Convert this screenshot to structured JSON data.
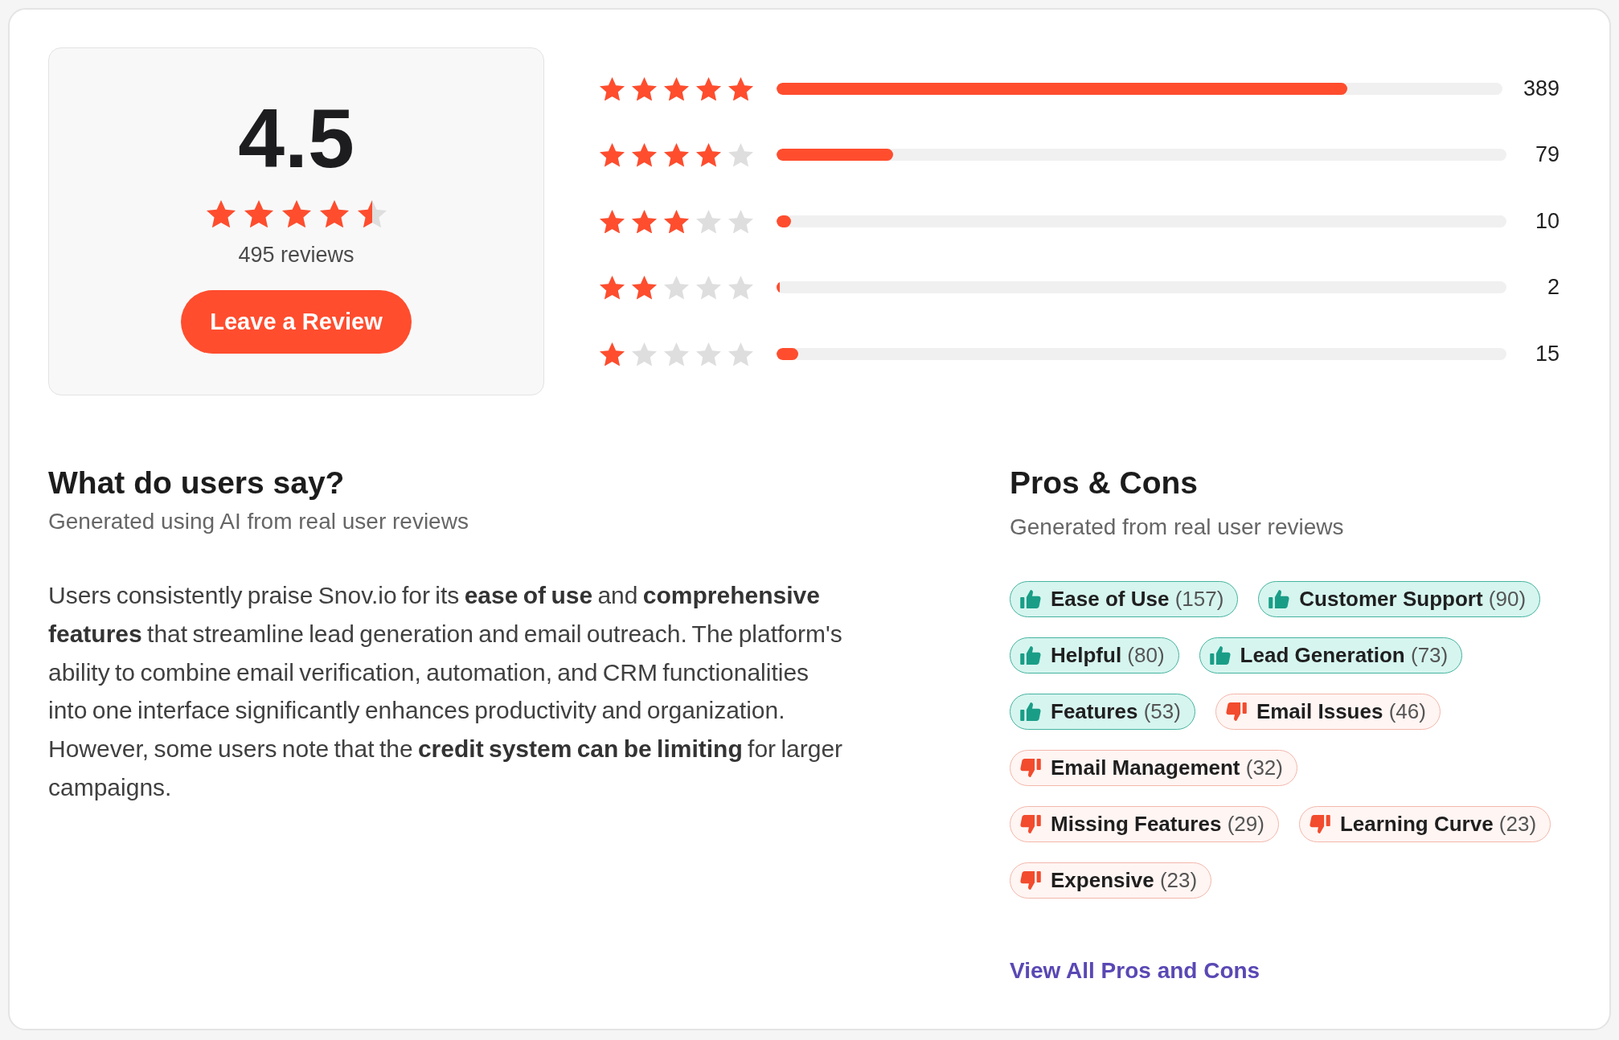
{
  "rating_summary": {
    "score": "4.5",
    "stars": 4.5,
    "reviews": "495 reviews",
    "button": "Leave a Review"
  },
  "distribution": [
    {
      "stars": 5,
      "level": 0.786,
      "count": "389"
    },
    {
      "stars": 4,
      "level": 0.16,
      "count": "79"
    },
    {
      "stars": 3,
      "level": 0.02,
      "count": "10"
    },
    {
      "stars": 2,
      "level": 0.004,
      "count": "2"
    },
    {
      "stars": 1,
      "level": 0.03,
      "count": "15"
    }
  ],
  "summary": {
    "title": "What do users say?",
    "subtitle": "Generated using AI from real user reviews",
    "text": "Users consistently praise Snov.io for its **ease of use** and **comprehensive features** that streamline lead generation and email outreach. The platform's ability to combine email verification, automation, and CRM functionalities into one interface significantly enhances productivity and organization. However, some users note that the **credit system can be limiting** for larger campaigns."
  },
  "pros_cons": {
    "title": "Pros & Cons",
    "subtitle": "Generated from real user reviews",
    "tags": [
      {
        "kind": "pro",
        "label": "Ease of Use",
        "count": "(157)"
      },
      {
        "kind": "pro",
        "label": "Customer Support",
        "count": "(90)"
      },
      {
        "kind": "pro",
        "label": "Helpful",
        "count": "(80)"
      },
      {
        "kind": "pro",
        "label": "Lead Generation",
        "count": "(73)"
      },
      {
        "kind": "pro",
        "label": "Features",
        "count": "(53)"
      },
      {
        "kind": "con",
        "label": "Email Issues",
        "count": "(46)"
      },
      {
        "kind": "con",
        "label": "Email Management",
        "count": "(32)"
      },
      {
        "kind": "con",
        "label": "Missing Features",
        "count": "(29)"
      },
      {
        "kind": "con",
        "label": "Learning Curve",
        "count": "(23)"
      },
      {
        "kind": "con",
        "label": "Expensive",
        "count": "(23)"
      }
    ],
    "link": "View All Pros and Cons"
  }
}
